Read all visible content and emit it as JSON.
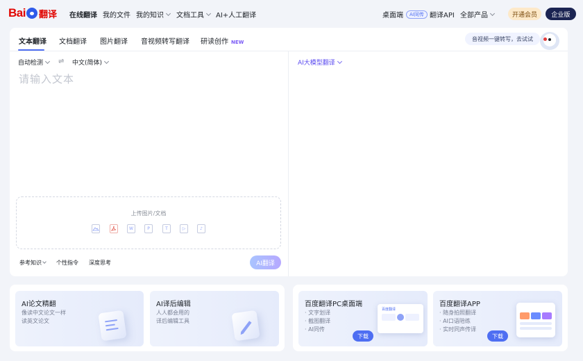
{
  "logo": {
    "part1": "Bai",
    "part2": "翻译"
  },
  "nav": {
    "items": [
      {
        "label": "在线翻译"
      },
      {
        "label": "我的文件"
      },
      {
        "label": "我的知识"
      },
      {
        "label": "文档工具"
      },
      {
        "label": "AI+人工翻译"
      }
    ],
    "desktop": "桌面端",
    "desktop_badge": "AI同传",
    "api": "翻译API",
    "all_products": "全部产品",
    "vip": "开通会员",
    "enterprise": "企业版"
  },
  "tabs": [
    {
      "label": "文本翻译"
    },
    {
      "label": "文档翻译"
    },
    {
      "label": "图片翻译"
    },
    {
      "label": "音视频转写翻译"
    },
    {
      "label": "研读创作",
      "tag": "NEW"
    }
  ],
  "promo": "音视频一键转写，去试试",
  "source": {
    "from_lang": "自动检测",
    "to_lang": "中文(简体)",
    "placeholder": "请输入文本",
    "upload_text": "上传图片/文档",
    "file_icons": [
      "img",
      "pdf",
      "W",
      "P",
      "T",
      "▷",
      "♪"
    ]
  },
  "target": {
    "model": "AI大模型翻译"
  },
  "chips": [
    {
      "label": "参考知识"
    },
    {
      "label": "个性指令"
    },
    {
      "label": "深度思考"
    }
  ],
  "translate_button": "AI翻译",
  "features": [
    {
      "title": "AI论文精翻",
      "desc": [
        "像读中文论文一样",
        "读英文论文"
      ]
    },
    {
      "title": "AI译后编辑",
      "desc": [
        "人人都会用的",
        "译后编辑工具"
      ]
    }
  ],
  "downloads": [
    {
      "title": "百度翻译PC桌面端",
      "items": [
        "· 文字划译",
        "· 截图翻译",
        "· AI同传"
      ],
      "button": "下载",
      "mock_label": "百度翻译"
    },
    {
      "title": "百度翻译APP",
      "items": [
        "· 随身拍照翻译",
        "· AI口语陪练",
        "· 实时同声传译"
      ],
      "button": "下载"
    }
  ]
}
